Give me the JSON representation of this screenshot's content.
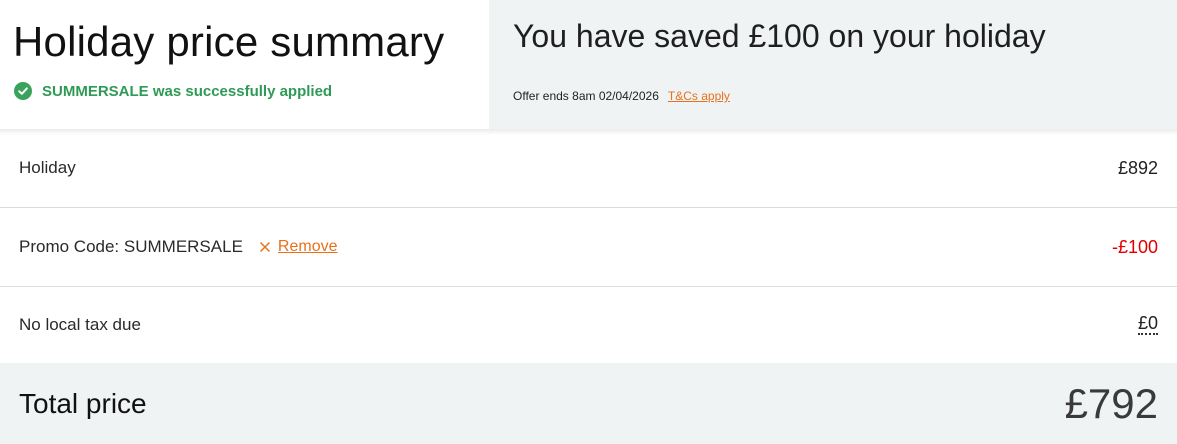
{
  "summary": {
    "title": "Holiday price summary",
    "promo_status": "SUMMERSALE was successfully applied"
  },
  "savings": {
    "headline": "You have saved £100 on your holiday",
    "offer_text": "Offer ends 8am 02/04/2026",
    "tcs_link": "T&Cs apply"
  },
  "rows": [
    {
      "label": "Holiday",
      "amount": "£892"
    },
    {
      "label": "Promo Code: SUMMERSALE",
      "remove_label": "Remove",
      "amount": "-£100"
    },
    {
      "label": "No local tax due",
      "amount": "£0"
    }
  ],
  "total": {
    "label": "Total price",
    "value": "£792"
  },
  "colors": {
    "accent": "#e8711c",
    "success": "#2f9a56",
    "discount": "#e10000",
    "panel_bg": "#f0f3f4"
  }
}
